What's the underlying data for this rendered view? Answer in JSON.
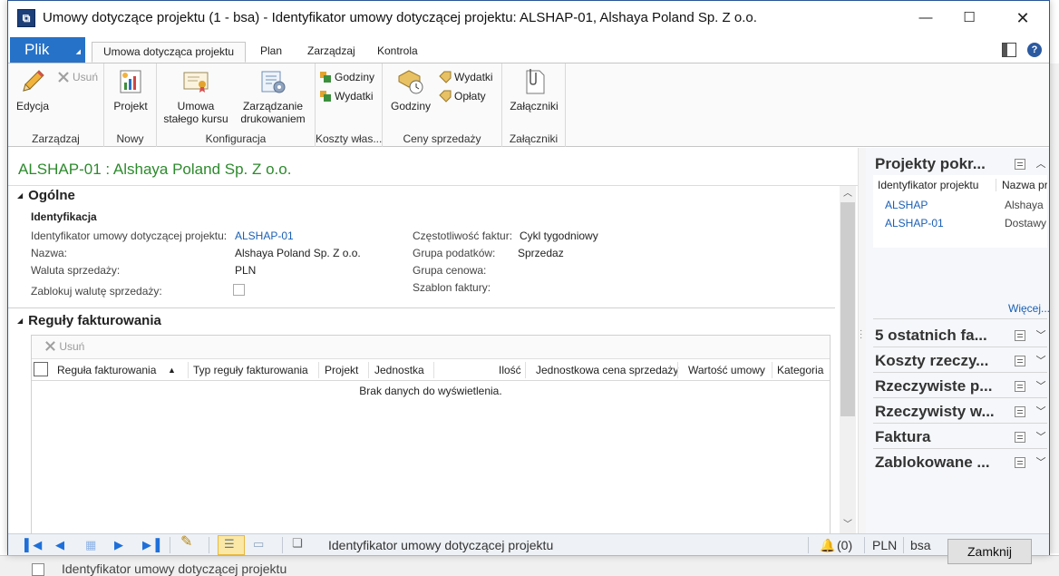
{
  "window": {
    "title": "Umowy dotyczące projektu (1 - bsa) - Identyfikator umowy dotyczącej projektu: ALSHAP-01, Alshaya Poland Sp. Z o.o.",
    "minimize": "—",
    "maximize": "☐",
    "close": "✕"
  },
  "ribbon": {
    "file_label": "Plik",
    "tabs": [
      "Umowa dotycząca projektu",
      "Plan",
      "Zarządzaj",
      "Kontrola"
    ],
    "groups": {
      "zarzadzaj": {
        "label": "Zarządzaj",
        "edit": "Edycja",
        "delete": "Usuń"
      },
      "nowy": {
        "label": "Nowy",
        "project": "Projekt"
      },
      "konfiguracja": {
        "label": "Konfiguracja",
        "fixed_rate": "Umowa\nstałego kursu",
        "print_mgmt": "Zarządzanie\ndrukowaniem"
      },
      "koszty": {
        "label": "Koszty włas...",
        "hours": "Godziny",
        "expenses": "Wydatki"
      },
      "ceny": {
        "label": "Ceny sprzedaży",
        "hours": "Godziny",
        "expenses": "Wydatki",
        "fees": "Opłaty"
      },
      "zalaczniki": {
        "label": "Załączniki",
        "attachments": "Załączniki"
      }
    }
  },
  "record": {
    "title": "ALSHAP-01 : Alshaya Poland Sp. Z o.o."
  },
  "general": {
    "header": "Ogólne",
    "subheader": "Identyfikacja",
    "contract_id_label": "Identyfikator umowy dotyczącej projektu:",
    "contract_id_value": "ALSHAP-01",
    "name_label": "Nazwa:",
    "name_value": "Alshaya Poland Sp. Z o.o.",
    "currency_label": "Waluta sprzedaży:",
    "currency_value": "PLN",
    "lock_currency_label": "Zablokuj walutę sprzedaży:",
    "invoice_freq_label": "Częstotliwość faktur:",
    "invoice_freq_value": "Cykl tygodniowy",
    "tax_group_label": "Grupa podatków:",
    "tax_group_value": "Sprzedaz",
    "price_group_label": "Grupa cenowa:",
    "invoice_template_label": "Szablon faktury:"
  },
  "billing": {
    "header": "Reguły fakturowania",
    "delete": "Usuń",
    "columns": [
      "Reguła fakturowania",
      "Typ reguły fakturowania",
      "Projekt",
      "Jednostka",
      "Ilość",
      "Jednostkowa cena sprzedaży",
      "Wartość umowy",
      "Kategoria"
    ],
    "sort_indicator": "▲",
    "empty": "Brak danych do wyświetlenia."
  },
  "factbox": {
    "projects_title": "Projekty pokr...",
    "projects_columns": [
      "Identyfikator projektu",
      "Nazwa pro"
    ],
    "projects_rows": [
      {
        "id": "ALSHAP",
        "name": "Alshaya P"
      },
      {
        "id": "ALSHAP-01",
        "name": "Dostawy"
      }
    ],
    "more": "Więcej...",
    "parts": [
      "5 ostatnich fa...",
      "Koszty rzeczy...",
      "Rzeczywiste p...",
      "Rzeczywisty w...",
      "Faktura",
      "Zablokowane ..."
    ]
  },
  "statusbar": {
    "field_help": "Identyfikator umowy dotyczącej projektu",
    "notifications": "(0)",
    "currency": "PLN",
    "company": "bsa",
    "close_button": "Zamknij"
  },
  "background": {
    "bottom_text": "Identyfikator umowy dotyczącej projektu"
  }
}
